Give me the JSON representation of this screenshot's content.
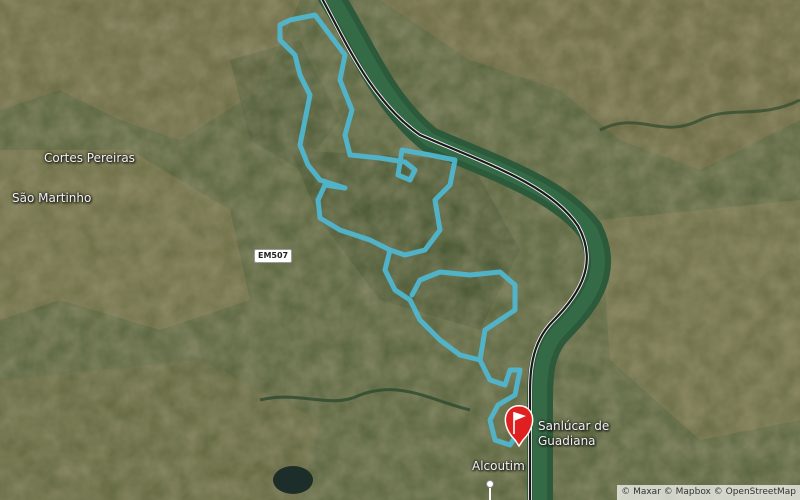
{
  "map": {
    "type": "satellite-route-map",
    "route_color": "#4fb8d3",
    "river_color": "#2f5a3a",
    "road_color": "#1a1a1a",
    "flag_color": "#e02020",
    "places": {
      "cortes_pereiras": "Cortes Pereiras",
      "sao_martinho": "São Martinho",
      "sanlucar_line1": "Sanlúcar de",
      "sanlucar_line2": "Guadiana",
      "alcoutim": "Alcoutim"
    },
    "road_shield": "EM507",
    "attribution": "© Maxar © Mapbox © OpenStreetMap"
  }
}
